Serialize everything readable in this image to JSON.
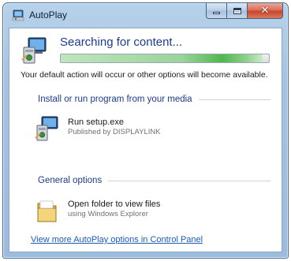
{
  "window": {
    "title": "AutoPlay",
    "controls": {
      "minimize": "minimize",
      "maximize": "maximize",
      "close": "✕"
    }
  },
  "search": {
    "heading": "Searching for content...",
    "progress": 0.97
  },
  "description": "Your default action will occur or other options will become available.",
  "sections": {
    "install": {
      "heading": "Install or run program from your media",
      "option": {
        "label": "Run setup.exe",
        "sublabel": "Published by DISPLAYLINK",
        "icon": "setup-program-icon"
      }
    },
    "general": {
      "heading": "General options",
      "option": {
        "label": "Open folder to view files",
        "sublabel": "using Windows Explorer",
        "icon": "folder-icon"
      }
    }
  },
  "footer": {
    "link": "View more AutoPlay options in Control Panel"
  },
  "colors": {
    "heading_blue": "#1e3a8c",
    "link_blue": "#1c5ab8",
    "progress_green": "#4fb84c"
  }
}
